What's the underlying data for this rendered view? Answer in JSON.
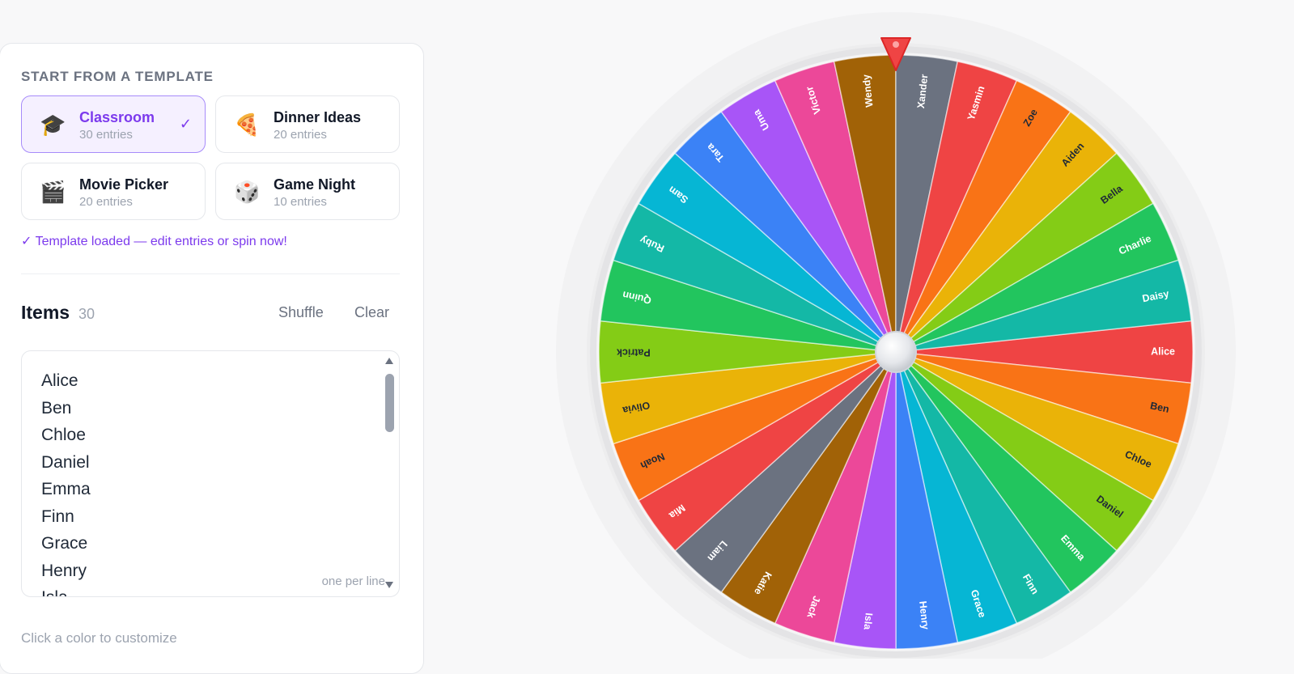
{
  "templates": {
    "heading": "START FROM A TEMPLATE",
    "cards": [
      {
        "title": "Classroom",
        "subtitle": "30 entries",
        "emoji": "🎓",
        "icon": "graduation-cap-icon",
        "selected": true
      },
      {
        "title": "Dinner Ideas",
        "subtitle": "20 entries",
        "emoji": "🍕",
        "icon": "pizza-icon",
        "selected": false
      },
      {
        "title": "Movie Picker",
        "subtitle": "20 entries",
        "emoji": "🎬",
        "icon": "clapperboard-icon",
        "selected": false
      },
      {
        "title": "Game Night",
        "subtitle": "10 entries",
        "emoji": "🎲",
        "icon": "dice-icon",
        "selected": false
      }
    ],
    "check_mark": "✓",
    "status_text": "✓ Template loaded — edit entries or spin now!"
  },
  "items": {
    "title": "Items",
    "count": "30",
    "shuffle_label": "Shuffle",
    "clear_label": "Clear",
    "visible_lines": [
      "Alice",
      "Ben",
      "Chloe",
      "Daniel",
      "Emma",
      "Finn",
      "Grace",
      "Henry",
      "Isla"
    ],
    "hint": "one per line"
  },
  "footer": {
    "customize_hint": "Click a color to customize"
  },
  "wheel": {
    "entries": [
      "Alice",
      "Ben",
      "Chloe",
      "Daniel",
      "Emma",
      "Finn",
      "Grace",
      "Henry",
      "Isla",
      "Jack",
      "Katie",
      "Liam",
      "Mia",
      "Noah",
      "Olivia",
      "Patrick",
      "Quinn",
      "Ruby",
      "Sam",
      "Tara",
      "Uma",
      "Victor",
      "Wendy",
      "Xander",
      "Yasmin",
      "Zoe",
      "Aiden",
      "Bella",
      "Charlie",
      "Daisy"
    ],
    "colors": [
      "#ef4444",
      "#f97316",
      "#eab308",
      "#84cc16",
      "#22c55e",
      "#14b8a6",
      "#06b6d4",
      "#3b82f6",
      "#a855f7",
      "#ec4899",
      "#a16207",
      "#6b7280"
    ],
    "pointer_color": "#ef4444",
    "selected_entry": "Wendy"
  }
}
